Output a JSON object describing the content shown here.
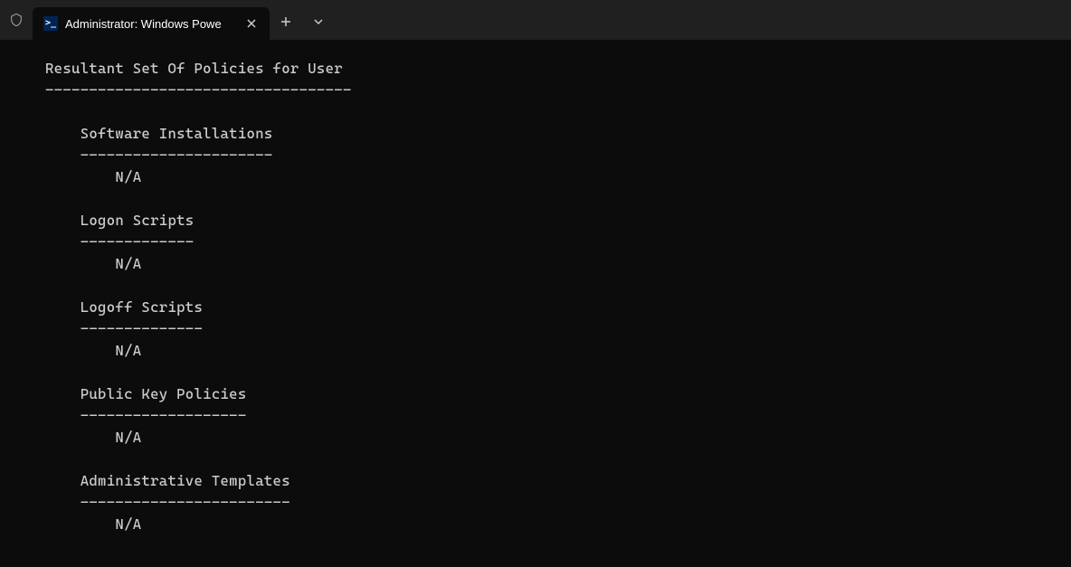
{
  "tab": {
    "title": "Administrator: Windows Powe"
  },
  "terminal": {
    "header_title": "Resultant Set Of Policies for User",
    "header_underline": "-----------------------------------",
    "sections": [
      {
        "title": "Software Installations",
        "underline": "----------------------",
        "value": "N/A"
      },
      {
        "title": "Logon Scripts",
        "underline": "-------------",
        "value": "N/A"
      },
      {
        "title": "Logoff Scripts",
        "underline": "--------------",
        "value": "N/A"
      },
      {
        "title": "Public Key Policies",
        "underline": "-------------------",
        "value": "N/A"
      },
      {
        "title": "Administrative Templates",
        "underline": "------------------------",
        "value": "N/A"
      }
    ]
  }
}
